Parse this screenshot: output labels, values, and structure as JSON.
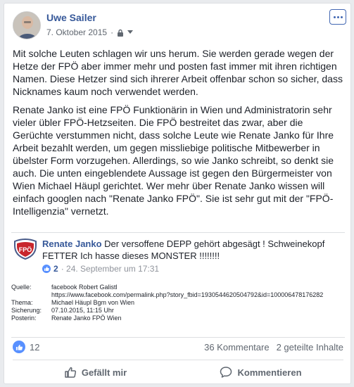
{
  "post": {
    "author": "Uwe Sailer",
    "date": "7. Oktober 2015",
    "privacy_icon": "lock-icon",
    "paragraphs": [
      "Mit solche Leuten schlagen wir uns herum. Sie werden gerade wegen der Hetze der FPÖ aber immer mehr und posten fast immer mit ihren richtigen Namen. Diese Hetzer sind sich ihrerer Arbeit offenbar schon so sicher, dass Nicknames kaum noch verwendet werden.",
      "Renate Janko ist eine FPÖ Funktionärin in Wien und Administratorin sehr vieler übler FPÖ-Hetzseiten. Die FPÖ bestreitet das zwar, aber die Gerüchte verstummen nicht, dass solche Leute wie Renate Janko für Ihre Arbeit bezahlt werden, um gegen missliebige politische Mitbewerber in übelster Form vorzugehen. Allerdings, so wie Janko schreibt, so denkt sie auch. Die unten eingeblendete Aussage ist gegen den Bürgermeister von Wien Michael Häupl gerichtet. Wer mehr über Renate Janko wissen will einfach googlen nach \"Renate Janko FPÖ\". Sie ist sehr gut mit der \"FPÖ-Intelligenzia\" vernetzt."
    ]
  },
  "embed": {
    "logo_text": "FPÖ",
    "name": "Renate Janko",
    "comment": "Der versoffene DEPP gehört abgesägt ! Schweinekopf FETTER Ich hasse dieses MONSTER !!!!!!!!",
    "likes": "2",
    "date": "· 24. September um 17:31",
    "sources": [
      {
        "key": "Quelle:",
        "value": "facebook Robert Galistl"
      },
      {
        "key": "",
        "value": "https://www.facebook.com/permalink.php?story_fbid=1930544620504792&id=100006478176282"
      },
      {
        "key": "Thema:",
        "value": "Michael Häupl Bgm von Wien"
      },
      {
        "key": "Sicherung:",
        "value": "07.10.2015, 11:15 Uhr"
      },
      {
        "key": "Posterin:",
        "value": "Renate Janko  FPÖ Wien"
      }
    ]
  },
  "stats": {
    "likes": "12",
    "comments": "36 Kommentare",
    "shares": "2 geteilte Inhalte"
  },
  "actions": {
    "like": "Gefällt mir",
    "comment": "Kommentieren"
  },
  "colors": {
    "link": "#365899",
    "accent": "#4267b2",
    "muted": "#606770"
  }
}
